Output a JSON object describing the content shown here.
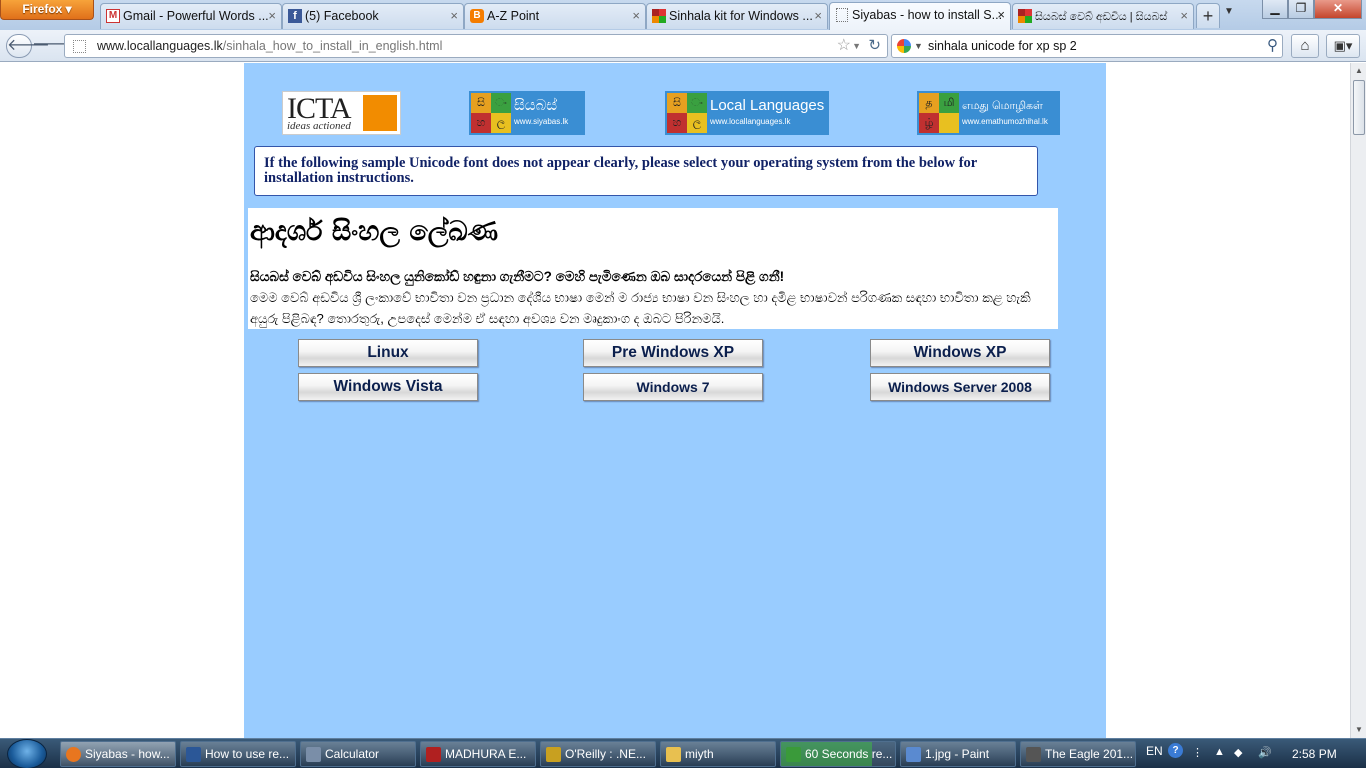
{
  "browser": {
    "menu_label": "Firefox",
    "tabs": [
      {
        "title": "Gmail - Powerful Words ...",
        "favicon": "gmail-icon"
      },
      {
        "title": "(5) Facebook",
        "favicon": "facebook-icon"
      },
      {
        "title": "A-Z Point",
        "favicon": "blogger-icon"
      },
      {
        "title": "Sinhala kit for Windows ...",
        "favicon": "siyabas-icon"
      },
      {
        "title": "Siyabas - how to install S...",
        "favicon": "blank-page-icon",
        "active": true
      },
      {
        "title": "සියබස් වෙබ් අඩවිය | සියබස්",
        "favicon": "siyabas-icon"
      }
    ],
    "tab_close_glyph": "×",
    "new_tab_glyph": "+",
    "url_host": "www.locallanguages.lk",
    "url_path": "/sinhala_how_to_install_in_english.html",
    "search_query": "sinhala unicode for xp sp 2"
  },
  "page": {
    "logos": [
      {
        "name": "ICTA",
        "tagline": "ideas actioned"
      },
      {
        "name": "සියබස්",
        "url": "www.siyabas.lk"
      },
      {
        "name": "Local Languages",
        "url": "www.locallanguages.lk"
      },
      {
        "name": "எமது மொழிகள்",
        "url": "www.emathumozhihal.lk"
      }
    ],
    "logo_letters_si": [
      "සි",
      "ං",
      "හ",
      "ල"
    ],
    "logo_letters_ta": [
      "த",
      "மி",
      "ழ்",
      ""
    ],
    "notice": "If the following sample Unicode font does not appear clearly, please select your operating system from the below for installation instructions.",
    "sample_title": "ආදර්ශ සිංහල ලේඛණ",
    "sample_bold": "සියබස් වෙබ් අඩවිය සිංහල යුනිකෝඩ් හඳුනා ගැනීමට? මෙහි පැමිණෙන ඔබ සාදරයෙන් පිළි ගනී!",
    "sample_body": "මෙම වෙබ් අඩවිය ශ්‍රී ලංකාවේ භාවිතා වන ප්‍රධාන දේශීය භාෂා මෙන් ම රාජ්‍ය භාෂා වන සිංහල හා දමිළ භාෂාවන් පරිගණක සඳහා භාවිතා කළ හැකි අයුරු පිළිබඳ? තොරතුරු, උපදෙස් මෙන්ම ඒ සඳහා අවශ්‍ය වන මෘදුකාංග ද ඔබට පිරිනමයි.",
    "os_buttons": [
      "Linux",
      "Pre Windows XP",
      "Windows XP",
      "Windows Vista",
      "Windows 7",
      "Windows Server 2008"
    ]
  },
  "taskbar": {
    "items": [
      {
        "label": "Siyabas - how...",
        "icon": "firefox-icon",
        "color": "#e8761f",
        "active": true
      },
      {
        "label": "How to use re...",
        "icon": "word-icon",
        "color": "#2b5797"
      },
      {
        "label": "Calculator",
        "icon": "calculator-icon",
        "color": "#7a8ea8"
      },
      {
        "label": "MADHURA E...",
        "icon": "madhura-icon",
        "color": "#b02020"
      },
      {
        "label": "O'Reilly : .NE...",
        "icon": "help-file-icon",
        "color": "#c8a020"
      },
      {
        "label": "miyth",
        "icon": "folder-icon",
        "color": "#e8c050"
      },
      {
        "label": "60 Seconds re...",
        "icon": "uploader-icon",
        "color": "#3a9a3a"
      },
      {
        "label": "1.jpg - Paint",
        "icon": "paint-icon",
        "color": "#5a8ad0"
      },
      {
        "label": "The Eagle 201...",
        "icon": "media-icon",
        "color": "#555"
      }
    ],
    "lang": "EN",
    "clock": "2:58 PM"
  }
}
